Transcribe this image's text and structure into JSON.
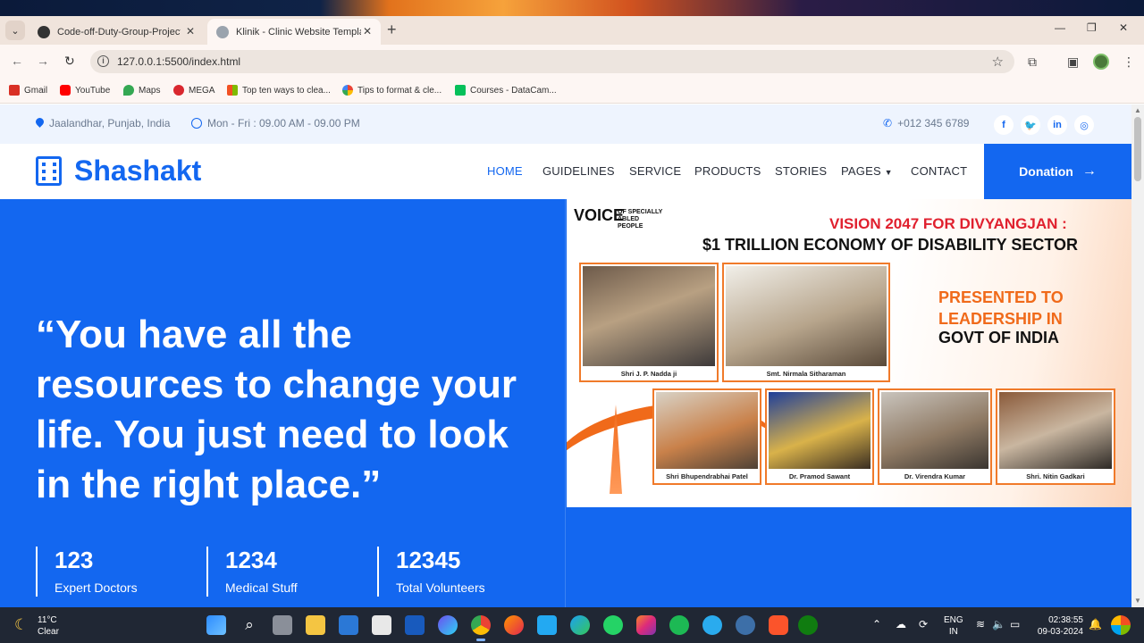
{
  "browser": {
    "tabs": [
      {
        "title": "Code-off-Duty-Group-Project/F",
        "icon": "github-icon"
      },
      {
        "title": "Klinik - Clinic Website Template",
        "icon": "globe-icon"
      }
    ],
    "url": "127.0.0.1:5500/index.html",
    "bookmarks": [
      "Gmail",
      "YouTube",
      "Maps",
      "MEGA",
      "Top ten ways to clea...",
      "Tips to format & cle...",
      "Courses - DataCam..."
    ]
  },
  "site": {
    "topbar": {
      "location": "Jaalandhar, Punjab, India",
      "hours": "Mon - Fri : 09.00 AM - 09.00 PM",
      "phone": "+012 345 6789",
      "social": [
        "f",
        "t",
        "in",
        "ig"
      ]
    },
    "brand": "Shashakt",
    "menu": [
      "HOME",
      "GUIDELINES",
      "SERVICE",
      "PRODUCTS",
      "STORIES",
      "PAGES",
      "CONTACT"
    ],
    "donate_label": "Donation",
    "hero": {
      "quote": "“You have all the resources to change your life. You just need to look in the right place.”",
      "stats": [
        {
          "num": "123",
          "label": "Expert Doctors"
        },
        {
          "num": "1234",
          "label": "Medical Stuff"
        },
        {
          "num": "12345",
          "label": "Total Volunteers"
        }
      ]
    },
    "poster": {
      "logo_main": "VOICE",
      "logo_sub": "OF SPECIALLY ABLED PEOPLE",
      "title1": "VISION 2047 FOR DIVYANGJAN :",
      "title2": "$1 TRILLION ECONOMY OF DISABILITY SECTOR",
      "presented": "PRESENTED TO LEADERSHIP IN",
      "govt": "GOVT OF INDIA",
      "captions": [
        "Shri J. P. Nadda ji",
        "Smt. Nirmala Sitharaman",
        "Shri Bhupendrabhai Patel",
        "Dr. Pramod Sawant",
        "Dr. Virendra Kumar",
        "Shri. Nitin Gadkari"
      ]
    }
  },
  "taskbar": {
    "temp": "11°C",
    "weather": "Clear",
    "lang1": "ENG",
    "lang2": "IN",
    "time": "02:38:55",
    "date": "09-03-2024"
  },
  "colors": {
    "primary": "#1367f0",
    "poster_red": "#e0202e",
    "poster_orange": "#f06a1a"
  }
}
